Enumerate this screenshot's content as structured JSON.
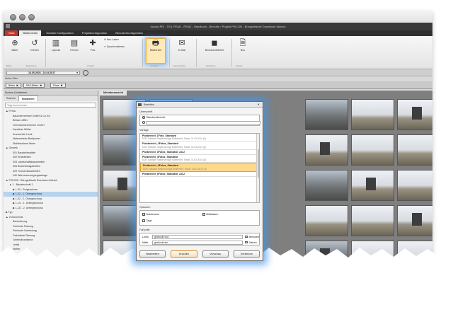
{
  "window": {
    "title": "docma PEI - TEIL PEAD - PEAD - Handbuch - Berichte / Projekt P05.205 - Bürogebäude Downtown Munich"
  },
  "ribbon_tabs": [
    {
      "label": "Start"
    },
    {
      "label": "Bildberichte"
    },
    {
      "label": "Globale Konfiguration"
    },
    {
      "label": "Projektkonfiguration"
    },
    {
      "label": "Benutzerkonfiguration"
    }
  ],
  "ribbon": {
    "buttons": [
      {
        "label": "Bilder",
        "icon": "plus-circle-icon"
      },
      {
        "label": "Drehen",
        "icon": "rotate-icon"
      },
      {
        "label": "Layouts",
        "icon": "layout-icon"
      },
      {
        "label": "Fenster",
        "icon": "window-icon"
      },
      {
        "label": "Pins",
        "icon": "pin-icon"
      },
      {
        "label": "Neu Laden",
        "icon": "refresh-icon"
      },
      {
        "label": "Synchronisieren",
        "icon": "sync-icon"
      },
      {
        "label": "Bildbericht",
        "icon": "printer-icon"
      },
      {
        "label": "E-Mail",
        "icon": "mail-icon"
      },
      {
        "label": "Benutzerdefiniert",
        "icon": "user-icon"
      },
      {
        "label": "Neu",
        "icon": "new-doc-icon"
      }
    ],
    "groups": [
      "Bilder",
      "Bearbeiten",
      "Ansicht",
      "Drucken",
      "Export/Teilen",
      "Erstellung",
      "Projekt"
    ]
  },
  "datebar": {
    "range": "16.05.2003 - 24.04.2017"
  },
  "filter": {
    "label": "Aktive Filter",
    "chips": [
      "Bilder",
      "RAF-Bilder",
      "Filme"
    ]
  },
  "left_panel": {
    "title": "Suchen & Indizieren",
    "tabs": [
      "Suchen",
      "Indizieren"
    ],
    "search_placeholder": "Tags durchsuchen",
    "tree": [
      {
        "label": "▲ Firma",
        "indent": 0
      },
      {
        "label": "Bauunternehmer GmbH & Co.KG",
        "indent": 2
      },
      {
        "label": "Brillau Löffler",
        "indent": 2
      },
      {
        "label": "Generalunternehmer GmbH",
        "indent": 2
      },
      {
        "label": "Kanalbau Müller",
        "indent": 2
      },
      {
        "label": "Kranverleih Hook",
        "indent": 2
      },
      {
        "label": "Malermeister Breitpinsel",
        "indent": 2
      },
      {
        "label": "Stahlbaufirma Meier",
        "indent": 2
      },
      {
        "label": "▲ Gewerk",
        "indent": 0
      },
      {
        "label": "001 Baustellenstelle",
        "indent": 2
      },
      {
        "label": "002 Erdarbeiten",
        "indent": 2
      },
      {
        "label": "003 Landschaftsbauarbeiten",
        "indent": 2
      },
      {
        "label": "026 Bodenbelagarbeiten",
        "indent": 2
      },
      {
        "label": "029 Trockenbauarbeiten",
        "indent": 2
      },
      {
        "label": "040 Wärmeversorgungsanlage",
        "indent": 2
      },
      {
        "label": "▲ P05.205 - Bürogebäude Downtown Munich",
        "indent": 0
      },
      {
        "label": "▲ 1 - Bauabschnitt 1",
        "indent": 1
      },
      {
        "label": "▶ 1-00 - Erdgeschoss",
        "indent": 2
      },
      {
        "label": "▶ 1-01 - 1. Obergeschoss",
        "indent": 2,
        "selected": true
      },
      {
        "label": "▶ 1-02 - 2. Obergeschoss",
        "indent": 2
      },
      {
        "label": "▶ 1-U1 - 1. Untergeschoss",
        "indent": 2
      },
      {
        "label": "▶ 1-U2 - 2. Untergeschoss",
        "indent": 2
      },
      {
        "label": "▶ Typ",
        "indent": 0
      },
      {
        "label": "▲ Vorkommnis",
        "indent": 0
      },
      {
        "label": "Behinderung",
        "indent": 2
      },
      {
        "label": "Fehlende Planung",
        "indent": 2
      },
      {
        "label": "Fehlende Vorleistung",
        "indent": 2
      },
      {
        "label": "Gebrüdete Planung",
        "indent": 2
      },
      {
        "label": "Jobstrukturalisma",
        "indent": 2
      },
      {
        "label": "Unfall",
        "indent": 2
      },
      {
        "label": "Wetter",
        "indent": 2
      }
    ]
  },
  "content": {
    "tab": "Miniaturansicht"
  },
  "dialog": {
    "title": "Berichte",
    "close": "✕",
    "uberschrift_label": "Überschrift",
    "uberschrift_value": "Standardbericht",
    "uberschrift_alt": "",
    "vorlage_label": "Vorlage",
    "templates": [
      {
        "name": "Plotbericht_1Foto_Standard",
        "desc": "EDR Software Mastervorlage Bildbericht, Stand: 31.03.2014 (A)"
      },
      {
        "name": "Fotobericht_2Fotos_Standard",
        "desc": "EDR Software Mastervorlage Bildbericht, Stand: 31.03.2014 (A)"
      },
      {
        "name": "Plotbericht_3Fotos_Standard_ACU",
        "desc": ""
      },
      {
        "name": "Plotbericht_4Fotos_Standard",
        "desc": "EDR Software Mastervorlage Bildbericht, Stand: 31.03.2014 (A)"
      },
      {
        "name": "Plotbericht_6Fotos_Standard",
        "desc": "EDR Software Mastervorlage Bildbericht, Stand: 28.03.2014 (A)",
        "selected": true
      },
      {
        "name": "Plotbericht_6Fotos_Standard_ACU",
        "desc": ""
      }
    ],
    "options_label": "Optionen",
    "options": [
      {
        "label": "Dateiname",
        "checked": true
      },
      {
        "label": "Bilddatum",
        "checked": true
      },
      {
        "label": "Tags",
        "checked": true
      }
    ],
    "footer_label": "Fußzeile",
    "footer_rows": [
      {
        "label": "Links",
        "value": "gedruckt von:",
        "check_label": "Benutzer",
        "checked": true
      },
      {
        "label": "Mitte",
        "value": "gedruckt am:",
        "check_label": "Datum",
        "checked": true
      }
    ],
    "buttons": [
      "Bearbeiten",
      "Drucken",
      "Vorschau",
      "Schließen"
    ]
  }
}
